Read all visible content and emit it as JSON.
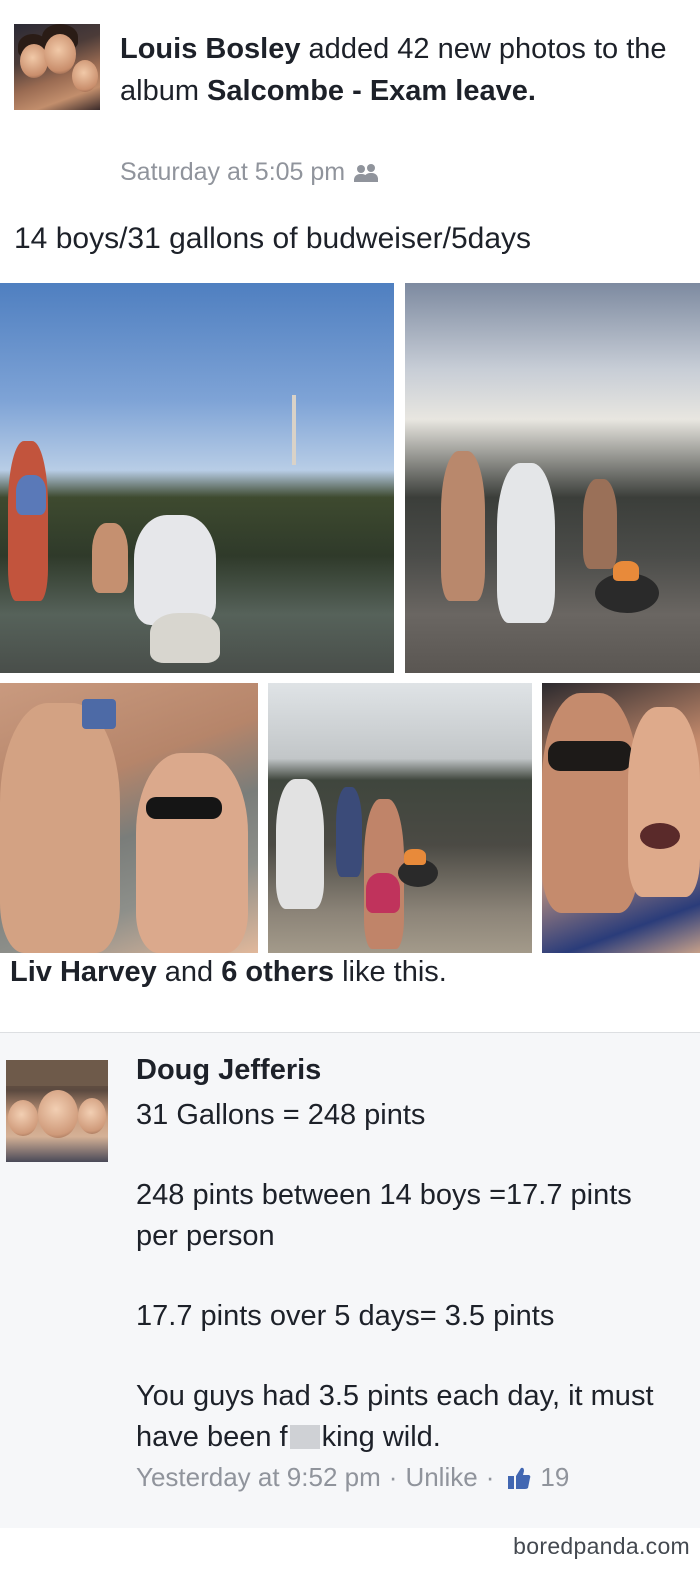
{
  "post": {
    "author": "Louis Bosley",
    "action": " added 42 new photos to the album ",
    "album": "Salcombe - Exam leave.",
    "timestamp": "Saturday at 5:05 pm",
    "privacy_icon": "friends-icon",
    "caption": "14 boys/31 gallons of budweiser/5days"
  },
  "reactions": {
    "liker": "Liv Harvey",
    "connector": " and ",
    "others": "6 others",
    "suffix": " like this."
  },
  "comment": {
    "author": "Doug Jefferis",
    "lines": [
      "31 Gallons = 248 pints",
      "248 pints between 14 boys =17.7 pints per person",
      "17.7 pints over 5 days= 3.5 pints"
    ],
    "last_line_start": "You guys had 3.5 pints each day, it must have been f",
    "last_line_end": "king wild.",
    "timestamp": "Yesterday at 9:52 pm",
    "separator": "·",
    "unlike_label": "Unlike",
    "like_count": "19",
    "like_icon": "thumbs-up-icon",
    "accent_color": "#4267b2"
  },
  "watermark": "boredpanda.com"
}
